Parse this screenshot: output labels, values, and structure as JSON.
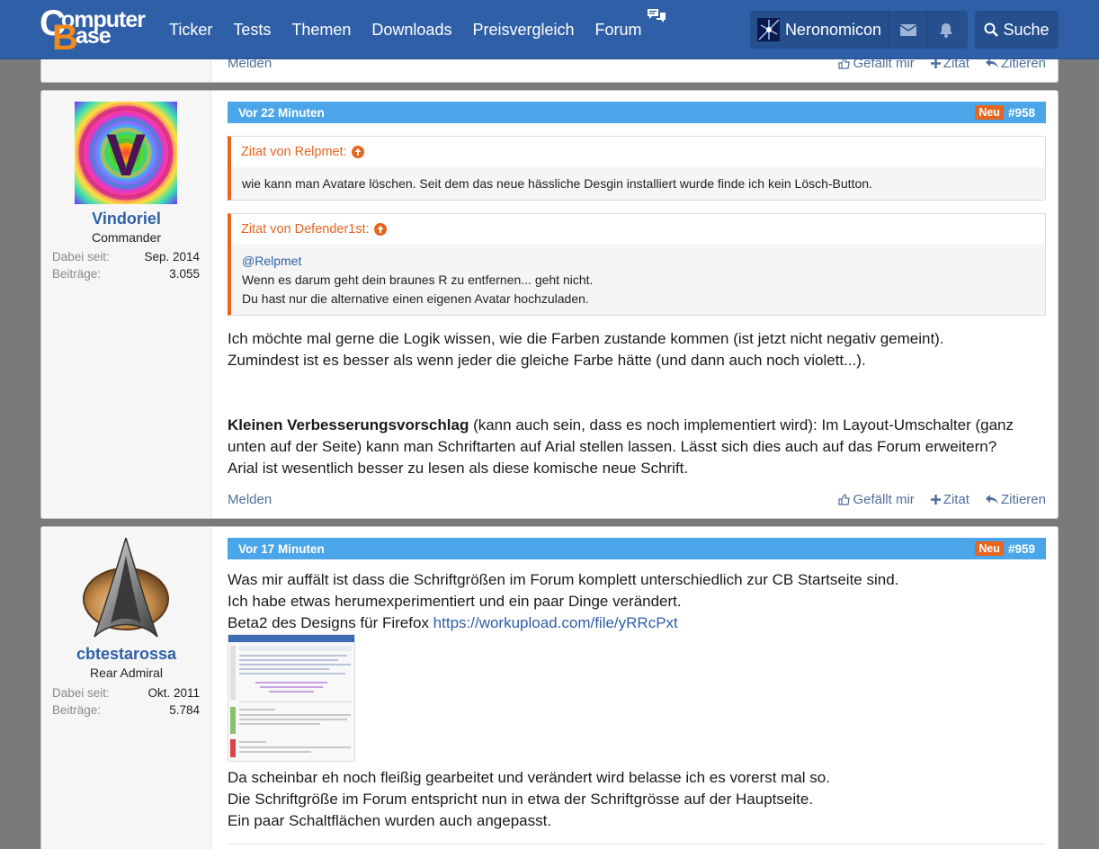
{
  "header": {
    "logo_line1": "omputer",
    "logo_line2": "ase",
    "logo_c": "C",
    "logo_b": "B",
    "nav": [
      "Ticker",
      "Tests",
      "Themen",
      "Downloads",
      "Preisvergleich",
      "Forum"
    ],
    "username": "Neronomicon",
    "search_label": "Suche"
  },
  "top_actions": {
    "report": "Melden",
    "like": "Gefällt mir",
    "plus_quote": "Zitat",
    "reply_quote": "Zitieren"
  },
  "posts": [
    {
      "time": "Vor 22 Minuten",
      "badge": "Neu",
      "number": "#958",
      "author": {
        "name": "Vindoriel",
        "title": "Commander",
        "since_label": "Dabei seit:",
        "since": "Sep. 2014",
        "posts_label": "Beiträge:",
        "posts": "3.055",
        "avatar_letter": "V"
      },
      "quotes": [
        {
          "author": "Zitat von Relpmet:",
          "lines": [
            "wie kann man Avatare löschen. Seit dem das neue hässliche Desgin installiert wurde finde ich kein Lösch-Button."
          ]
        },
        {
          "author": "Zitat von Defender1st:",
          "mention": "@Relpmet",
          "lines": [
            "Wenn es darum geht dein braunes R zu entfernen... geht nicht.",
            "Du hast nur die alternative einen eigenen Avatar hochzuladen."
          ]
        }
      ],
      "paragraph1": [
        "Ich möchte mal gerne die Logik wissen, wie die Farben zustande kommen (ist jetzt nicht negativ gemeint).",
        "Zumindest ist es besser als wenn jeder die gleiche Farbe hätte (und dann auch noch violett...)."
      ],
      "bold_lead": "Kleinen Verbesserungsvorschlag",
      "paragraph2_line1_rest": " (kann auch sein, dass es noch implementiert wird): Im Layout-Umschalter (ganz",
      "paragraph2_lines": [
        "unten auf der Seite) kann man Schriftarten auf Arial stellen lassen. Lässt sich dies auch auf das Forum erweitern?",
        "Arial ist wesentlich besser zu lesen als diese komische neue Schrift."
      ],
      "actions": {
        "report": "Melden",
        "like": "Gefällt mir",
        "plus_quote": "Zitat",
        "reply_quote": "Zitieren"
      }
    },
    {
      "time": "Vor 17 Minuten",
      "badge": "Neu",
      "number": "#959",
      "author": {
        "name": "cbtestarossa",
        "title": "Rear Admiral",
        "since_label": "Dabei seit:",
        "since": "Okt. 2011",
        "posts_label": "Beiträge:",
        "posts": "5.784"
      },
      "lines_top": [
        "Was mir auffält ist dass die Schriftgrößen im Forum komplett unterschiedlich zur CB Startseite sind.",
        "Ich habe etwas herumexperimentiert und ein paar Dinge verändert."
      ],
      "link_prefix": "Beta2 des Designs für Firefox ",
      "link": "https://workupload.com/file/yRRcPxt",
      "lines_bottom": [
        "Da scheinbar eh noch fleißig gearbeitet und verändert wird belasse ich es vorerst mal so.",
        "Die Schriftgröße im Forum entspricht nun in etwa der Schriftgrösse auf der Hauptseite.",
        "Ein paar Schaltflächen wurden auch angepasst."
      ]
    }
  ]
}
